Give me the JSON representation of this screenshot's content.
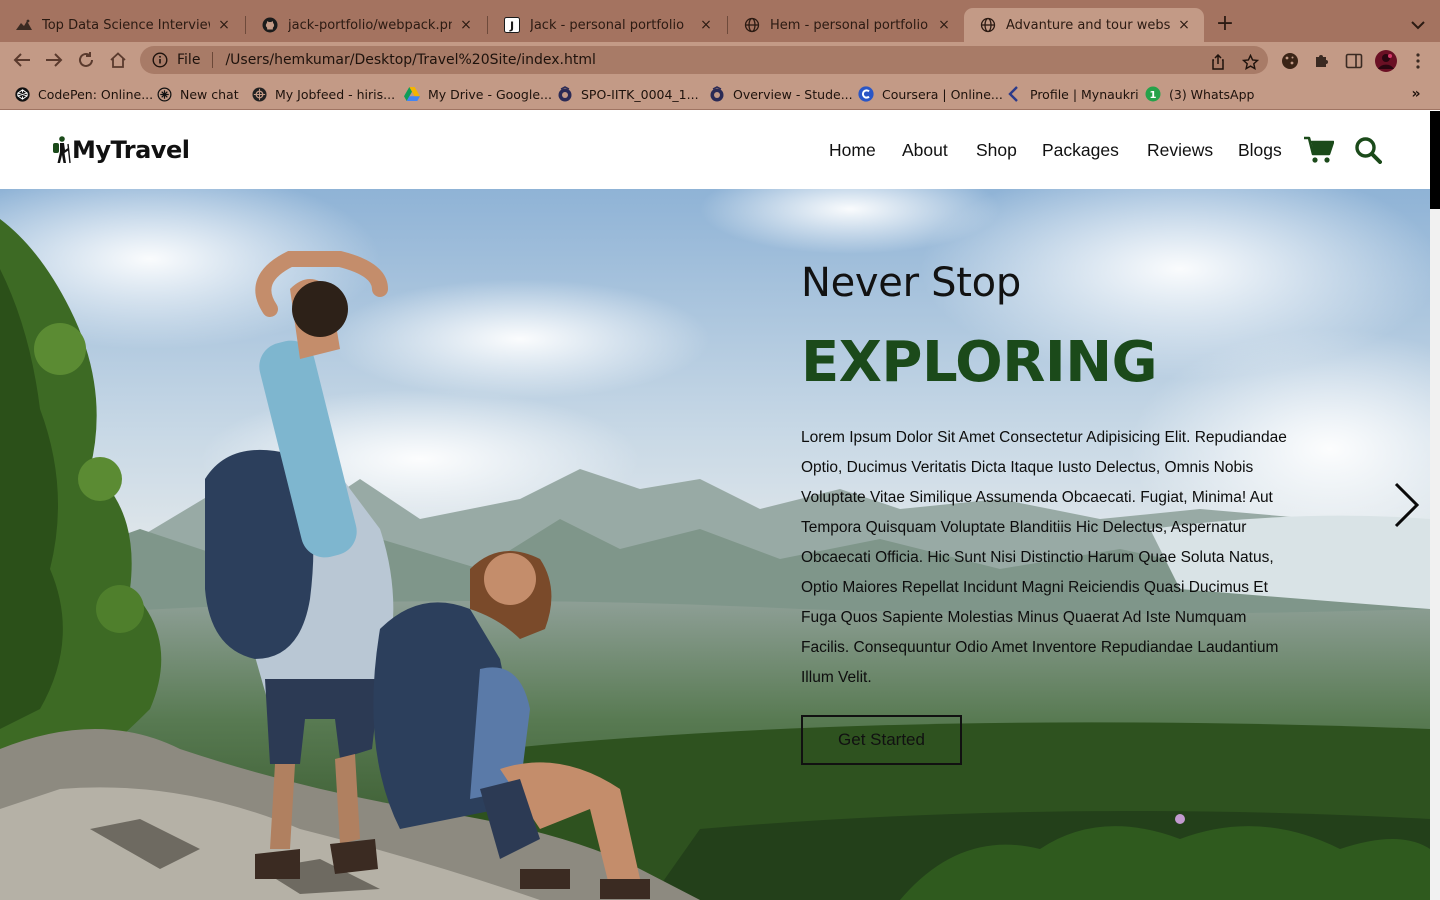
{
  "browser": {
    "tabs": [
      {
        "title": "Top Data Science Interview Qu",
        "icon": "mountain-favicon"
      },
      {
        "title": "jack-portfolio/webpack.png at",
        "icon": "github-icon"
      },
      {
        "title": "Jack - personal portfolio",
        "icon": "j-letter-favicon"
      },
      {
        "title": "Hem - personal portfolio",
        "icon": "globe-icon"
      },
      {
        "title": "Advanture and tour website de",
        "icon": "globe-icon"
      }
    ],
    "close_glyph": "×",
    "newtab_glyph": "+",
    "address": {
      "scheme": "File",
      "url": "/Users/hemkumar/Desktop/Travel%20Site/index.html"
    },
    "bookmarks": [
      {
        "label": "CodePen: Online...",
        "icon": "codepen-icon"
      },
      {
        "label": "New chat",
        "icon": "chatgpt-icon"
      },
      {
        "label": "My Jobfeed - hiris...",
        "icon": "jobfeed-icon"
      },
      {
        "label": "My Drive - Google...",
        "icon": "google-drive-icon"
      },
      {
        "label": "SPO-IITK_0004_1...",
        "icon": "iitk-icon"
      },
      {
        "label": "Overview - Stude...",
        "icon": "iitk-icon"
      },
      {
        "label": "Coursera | Online...",
        "icon": "coursera-icon"
      },
      {
        "label": "Profile | Mynaukri",
        "icon": "naukri-icon"
      },
      {
        "label": "(3) WhatsApp",
        "icon": "whatsapp-icon"
      }
    ],
    "bookmarks_more": "»",
    "whatsapp_badge": "1"
  },
  "site": {
    "logo_text": "MyTravel",
    "nav": [
      "Home",
      "About",
      "Shop",
      "Packages",
      "Reviews",
      "Blogs"
    ],
    "hero": {
      "kicker": "Never Stop",
      "headline": "EXPLORING",
      "body": "Lorem Ipsum Dolor Sit Amet Consectetur Adipisicing Elit. Repudiandae Optio, Ducimus Veritatis Dicta Itaque Iusto Delectus, Omnis Nobis Voluptate Vitae Similique Assumenda Obcaecati. Fugiat, Minima! Aut Tempora Quisquam Voluptate Blanditiis Hic Delectus, Aspernatur Obcaecati Officia. Hic Sunt Nisi Distinctio Harum Quae Soluta Natus, Optio Maiores Repellat Incidunt Magni Reiciendis Quasi Ducimus Et Fuga Quos Sapiente Molestias Minus Quaerat Ad Iste Numquam Facilis. Consequuntur Odio Amet Inventore Repudiandae Laudantium Illum Velit.",
      "cta": "Get Started"
    }
  },
  "colors": {
    "chrome_dark": "#a47360",
    "chrome_light": "#c39a86",
    "brand_green": "#1b4a1a",
    "text_dark": "#111111"
  }
}
